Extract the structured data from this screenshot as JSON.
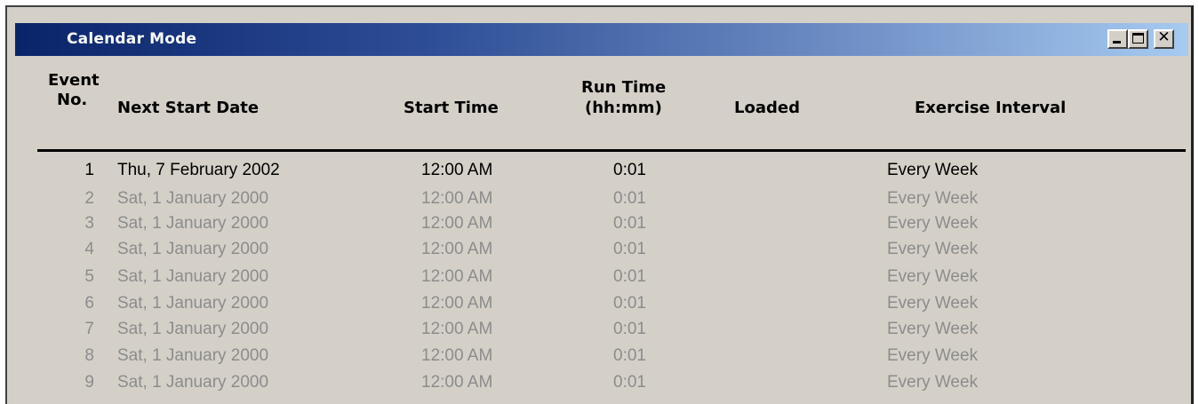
{
  "window": {
    "title": "Calendar Mode",
    "controls": {
      "minimize_icon": "minimize-icon",
      "maximize_icon": "maximize-icon",
      "close_icon": "close-icon",
      "close_glyph": "✕"
    }
  },
  "colors": {
    "titlebar_start": "#0a246a",
    "titlebar_end": "#a6caf0",
    "window_bg": "#d4d0c8",
    "active_text": "#000000",
    "disabled_text": "#8c8c8c"
  },
  "table": {
    "headers": {
      "event_no_line1": "Event",
      "event_no_line2": "No.",
      "next_start_date": "Next Start Date",
      "start_time": "Start Time",
      "run_time_line1": "Run Time",
      "run_time_line2": "(hh:mm)",
      "loaded": "Loaded",
      "exercise_interval": "Exercise Interval"
    },
    "rows": [
      {
        "no": "1",
        "date": "Thu, 7 February 2002",
        "start": "12:00 AM",
        "run": "0:01",
        "loaded": "",
        "interval": "Every Week",
        "enabled": true
      },
      {
        "no": "2",
        "date": "Sat, 1 January 2000",
        "start": "12:00 AM",
        "run": "0:01",
        "loaded": "",
        "interval": "Every Week",
        "enabled": false
      },
      {
        "no": "3",
        "date": "Sat, 1 January 2000",
        "start": "12:00 AM",
        "run": "0:01",
        "loaded": "",
        "interval": "Every Week",
        "enabled": false
      },
      {
        "no": "4",
        "date": "Sat, 1 January 2000",
        "start": "12:00 AM",
        "run": "0:01",
        "loaded": "",
        "interval": "Every Week",
        "enabled": false
      },
      {
        "no": "5",
        "date": "Sat, 1 January 2000",
        "start": "12:00 AM",
        "run": "0:01",
        "loaded": "",
        "interval": "Every Week",
        "enabled": false
      },
      {
        "no": "6",
        "date": "Sat, 1 January 2000",
        "start": "12:00 AM",
        "run": "0:01",
        "loaded": "",
        "interval": "Every Week",
        "enabled": false
      },
      {
        "no": "7",
        "date": "Sat, 1 January 2000",
        "start": "12:00 AM",
        "run": "0:01",
        "loaded": "",
        "interval": "Every Week",
        "enabled": false
      },
      {
        "no": "8",
        "date": "Sat, 1 January 2000",
        "start": "12:00 AM",
        "run": "0:01",
        "loaded": "",
        "interval": "Every Week",
        "enabled": false
      },
      {
        "no": "9",
        "date": "Sat, 1 January 2000",
        "start": "12:00 AM",
        "run": "0:01",
        "loaded": "",
        "interval": "Every Week",
        "enabled": false
      }
    ]
  }
}
